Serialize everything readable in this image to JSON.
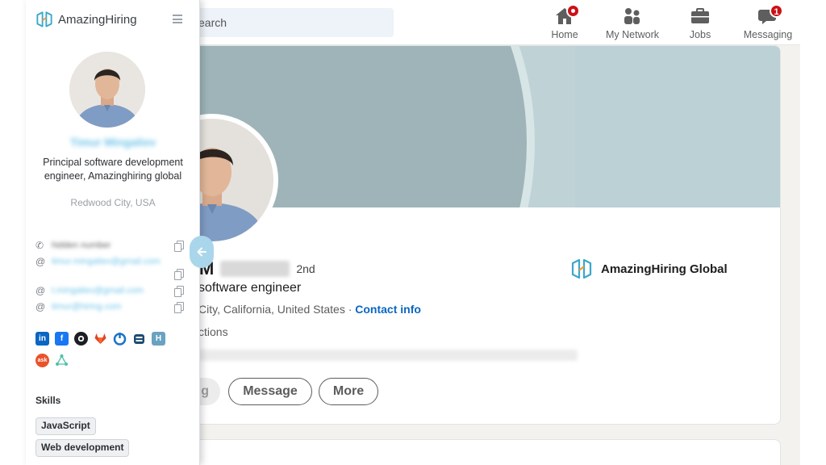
{
  "linkedin": {
    "search_placeholder": "Search",
    "search_visible": "earch",
    "nav": [
      {
        "label": "Home",
        "icon": "home-icon",
        "badge": ""
      },
      {
        "label": "My Network",
        "icon": "network-icon",
        "badge": ""
      },
      {
        "label": "Jobs",
        "icon": "briefcase-icon",
        "badge": ""
      },
      {
        "label": "Messaging",
        "icon": "messaging-icon",
        "badge": "1"
      }
    ],
    "profile": {
      "name_initial": "M",
      "degree": "2nd",
      "headline": "software engineer",
      "location": "City, California, United States · ",
      "contact_info": "Contact info",
      "connections": "ctions",
      "company": "AmazingHiring Global"
    },
    "buttons": {
      "follow": "g",
      "message": "Message",
      "more": "More"
    }
  },
  "amazinghiring": {
    "logo_text": "AmazingHiring",
    "name": "Timur Mingaliev",
    "title": "Principal software development engineer, Amazinghiring global",
    "location": "Redwood City, USA",
    "contacts": [
      {
        "icon": "phone-icon",
        "symbol": "✆",
        "value": "hidden number"
      },
      {
        "icon": "email-icon",
        "symbol": "@",
        "value": "timur.mingaliev@gmail.com"
      },
      {
        "icon": "email-icon",
        "symbol": "@",
        "value": "t.mingaliev@gmail.com"
      },
      {
        "icon": "email-icon",
        "symbol": "@",
        "value": "timur@hiring.com"
      }
    ],
    "skills_title": "Skills",
    "skills": [
      "JavaScript",
      "Web development"
    ],
    "colors": {
      "accent": "#6fc4e8",
      "linkedin": "#0a66c2",
      "facebook": "#1877f2",
      "github": "#1b1f23",
      "gitlab": "#e24329",
      "stackoverflow": "#f48024",
      "habr": "#6aa2c1"
    }
  }
}
